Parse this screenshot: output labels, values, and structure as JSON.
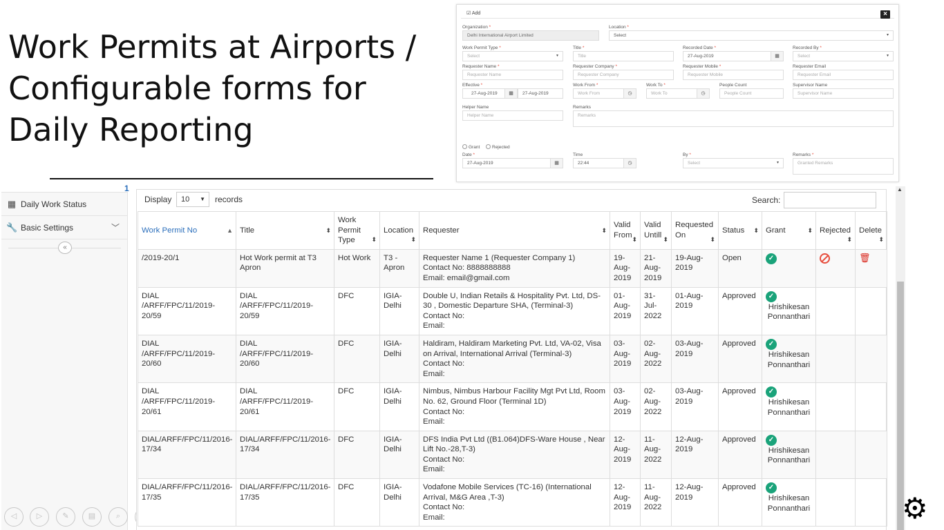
{
  "slide": {
    "title": "Work Permits at Airports / Configurable forms for Daily Reporting"
  },
  "form": {
    "header_label": "Add",
    "close_label": "×",
    "organization_label": "Organization",
    "organization_value": "Delhi International Airport Limited",
    "location_label": "Location",
    "location_value": "Select",
    "work_permit_type_label": "Work Permit Type",
    "work_permit_type_value": "Select",
    "title_label": "Title",
    "title_placeholder": "Title",
    "recorded_date_label": "Recorded Date",
    "recorded_date_value": "27-Aug-2019",
    "recorded_by_label": "Recorded By",
    "recorded_by_value": "Select",
    "requester_name_label": "Requester Name",
    "requester_name_placeholder": "Requester Name",
    "requester_company_label": "Requester Company",
    "requester_company_placeholder": "Requester Company",
    "requester_mobile_label": "Requester Mobile",
    "requester_mobile_placeholder": "Requester Mobile",
    "requester_email_label": "Requester Email",
    "requester_email_placeholder": "Requester Email",
    "effective_label": "Effective",
    "effective_from": "27-Aug-2019",
    "effective_to": "27-Aug-2019",
    "work_from_label": "Work From",
    "work_from_placeholder": "Work From",
    "work_to_label": "Work To",
    "work_to_placeholder": "Work To",
    "people_count_label": "People Count",
    "people_count_placeholder": "People Count",
    "supervisor_name_label": "Supervisor Name",
    "supervisor_name_placeholder": "Supervisor Name",
    "helper_name_label": "Helper Name",
    "helper_name_placeholder": "Helper Name",
    "remarks_label": "Remarks",
    "remarks_placeholder": "Remarks",
    "grant_label": "Grant",
    "rejected_label": "Rejected",
    "date_label": "Date",
    "date_value": "27-Aug-2019",
    "time_label": "Time",
    "time_value": "22:44",
    "by_label": "By",
    "by_value": "Select",
    "grant_remarks_label": "Remarks",
    "grant_remarks_placeholder": "Granted Remarks"
  },
  "sidebar": {
    "marker": "1",
    "items": [
      {
        "label": "Daily Work Status",
        "icon": "calendar-icon"
      },
      {
        "label": "Basic Settings",
        "icon": "wrench-icon"
      }
    ],
    "collapse_label": "«"
  },
  "table_controls": {
    "display_label": "Display",
    "display_value": "10",
    "records_label": "records",
    "search_label": "Search:"
  },
  "table": {
    "columns": [
      "Work Permit No",
      "Title",
      "Work Permit Type",
      "Location",
      "Requester",
      "Valid From",
      "Valid Untill",
      "Requested On",
      "Status",
      "Grant",
      "Rejected",
      "Delete"
    ],
    "rows": [
      {
        "permit_no": "/2019-20/1",
        "title": "Hot Work permit at T3 Apron",
        "type": "Hot Work",
        "location": "T3 - Apron",
        "requester": "Requester Name 1 (Requester Company 1)",
        "contact": "Contact No: 8888888888",
        "email": "Email: email@gmail.com",
        "valid_from": "19-Aug-2019",
        "valid_until": "21-Aug-2019",
        "requested_on": "19-Aug-2019",
        "status": "Open",
        "grant_by": ""
      },
      {
        "permit_no": "DIAL /ARFF/FPC/11/2019-20/59",
        "title": "DIAL /ARFF/FPC/11/2019-20/59",
        "type": "DFC",
        "location": "IGIA-Delhi",
        "requester": "Double U, Indian Retails & Hospitality Pvt. Ltd, DS-30 , Domestic Departure SHA, (Terminal-3)",
        "contact": "Contact No:",
        "email": "Email:",
        "valid_from": "01-Aug-2019",
        "valid_until": "31-Jul-2022",
        "requested_on": "01-Aug-2019",
        "status": "Approved",
        "grant_by": "Hrishikesan Ponnanthari"
      },
      {
        "permit_no": "DIAL /ARFF/FPC/11/2019-20/60",
        "title": "DIAL /ARFF/FPC/11/2019-20/60",
        "type": "DFC",
        "location": "IGIA-Delhi",
        "requester": "Haldiram, Haldiram Marketing Pvt. Ltd, VA-02, Visa on Arrival, International Arrival (Terminal-3)",
        "contact": "Contact No:",
        "email": "Email:",
        "valid_from": "03-Aug-2019",
        "valid_until": "02-Aug-2022",
        "requested_on": "03-Aug-2019",
        "status": "Approved",
        "grant_by": "Hrishikesan Ponnanthari"
      },
      {
        "permit_no": "DIAL /ARFF/FPC/11/2019-20/61",
        "title": "DIAL /ARFF/FPC/11/2019-20/61",
        "type": "DFC",
        "location": "IGIA-Delhi",
        "requester": "Nimbus, Nimbus Harbour Facility Mgt Pvt Ltd, Room No. 62, Ground Floor (Terminal 1D)",
        "contact": "Contact No:",
        "email": "Email:",
        "valid_from": "03-Aug-2019",
        "valid_until": "02-Aug-2022",
        "requested_on": "03-Aug-2019",
        "status": "Approved",
        "grant_by": "Hrishikesan Ponnanthari"
      },
      {
        "permit_no": "DIAL/ARFF/FPC/11/2016-17/34",
        "title": "DIAL/ARFF/FPC/11/2016-17/34",
        "type": "DFC",
        "location": "IGIA-Delhi",
        "requester": "DFS India Pvt Ltd ((B1.064)DFS-Ware House , Near Lift No.-28,T-3)",
        "contact": "Contact No:",
        "email": "Email:",
        "valid_from": "12-Aug-2019",
        "valid_until": "11-Aug-2022",
        "requested_on": "12-Aug-2019",
        "status": "Approved",
        "grant_by": "Hrishikesan Ponnanthari"
      },
      {
        "permit_no": "DIAL/ARFF/FPC/11/2016-17/35",
        "title": "DIAL/ARFF/FPC/11/2016-17/35",
        "type": "DFC",
        "location": "IGIA-Delhi",
        "requester": "Vodafone Mobile Services (TC-16) (International Arrival, M&G Area ,T-3)",
        "contact": "Contact No:",
        "email": "Email:",
        "valid_from": "12-Aug-2019",
        "valid_until": "11-Aug-2022",
        "requested_on": "12-Aug-2019",
        "status": "Approved",
        "grant_by": "Hrishikesan Ponnanthari"
      }
    ]
  },
  "colors": {
    "accent_blue": "#2a6ebb",
    "grant_green": "#1aa37a",
    "reject_red": "#e74c3c"
  }
}
